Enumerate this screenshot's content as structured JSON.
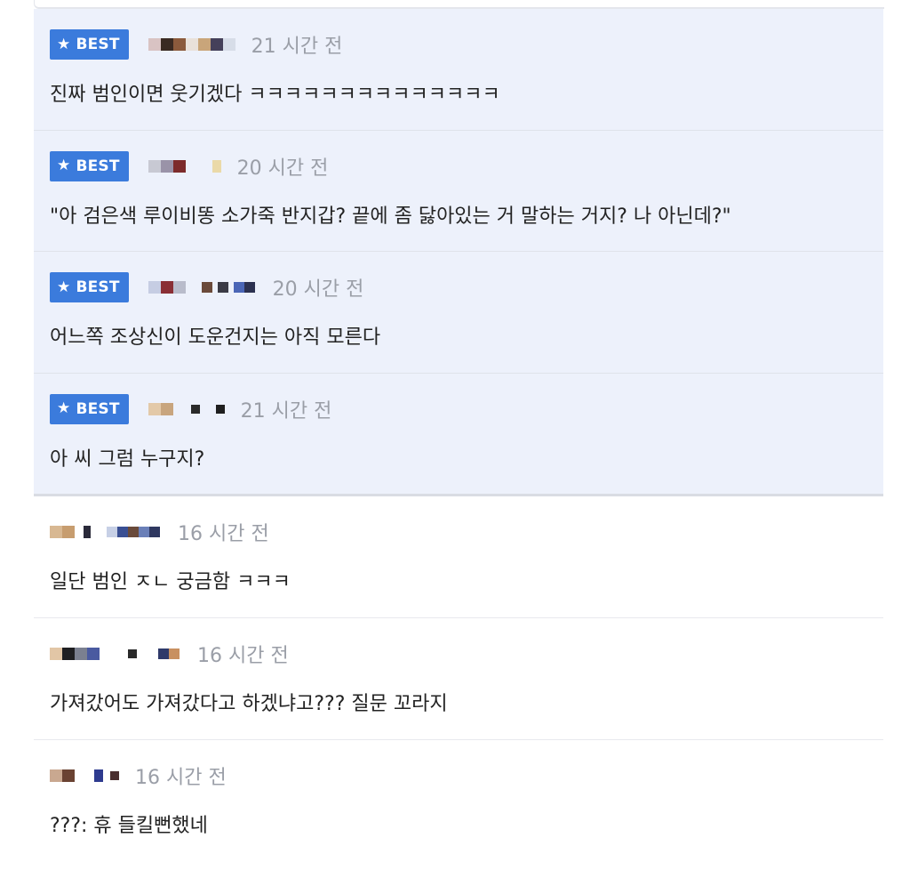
{
  "comments": [
    {
      "best": true,
      "best_label": "BEST",
      "time": "21 시간 전",
      "text": "진짜 범인이면 웃기겠다 ㅋㅋㅋㅋㅋㅋㅋㅋㅋㅋㅋㅋㅋㅋ"
    },
    {
      "best": true,
      "best_label": "BEST",
      "time": "20 시간 전",
      "text": "\"아 검은색 루이비똥 소가죽 반지갑? 끝에 좀 닳아있는 거 말하는 거지? 나 아닌데?\""
    },
    {
      "best": true,
      "best_label": "BEST",
      "time": "20 시간 전",
      "text": "어느쪽 조상신이 도운건지는 아직 모른다"
    },
    {
      "best": true,
      "best_label": "BEST",
      "time": "21 시간 전",
      "text": "아 씨 그럼 누구지?"
    },
    {
      "best": false,
      "time": "16 시간 전",
      "text": "일단 범인 ㅈㄴ 궁금함 ㅋㅋㅋ"
    },
    {
      "best": false,
      "time": "16 시간 전",
      "text": "가져갔어도 가져갔다고 하겠냐고??? 질문 꼬라지"
    },
    {
      "best": false,
      "time": "16 시간 전",
      "text": "???: 휴 들킬뻔했네"
    }
  ],
  "icons": {
    "best_badge": "star-icon",
    "avatar": "blurred-avatar",
    "nickname": "blurred-nickname"
  },
  "colors": {
    "best_badge": "#3b7bdc",
    "best_background": "#edf1fb",
    "time_text": "#9a9ea7"
  }
}
